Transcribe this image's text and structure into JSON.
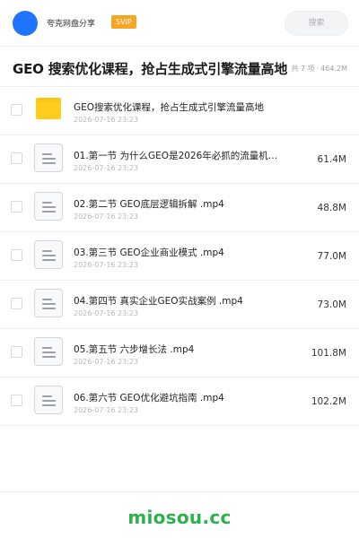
{
  "header": {
    "share_name": "夸克网盘分享",
    "badge": "SVIP",
    "search_placeholder": "搜索"
  },
  "title": "GEO 搜索优化课程，抢占生成式引擎流量高地",
  "summary": {
    "count": "共 7 项",
    "separator": "·",
    "total_size": "464.2M"
  },
  "items": [
    {
      "type": "folder",
      "name": "GEO搜索优化课程，抢占生成式引擎流量高地",
      "date": "2026-07-16 23:23",
      "size": ""
    },
    {
      "type": "file",
      "name": "01.第一节 为什么GEO是2026年必抓的流量机…",
      "date": "2026-07-16 23:23",
      "size": "61.4M"
    },
    {
      "type": "file",
      "name": "02.第二节 GEO底层逻辑拆解 .mp4",
      "date": "2026-07-16 23:23",
      "size": "48.8M"
    },
    {
      "type": "file",
      "name": "03.第三节 GEO企业商业模式 .mp4",
      "date": "2026-07-16 23:23",
      "size": "77.0M"
    },
    {
      "type": "file",
      "name": "04.第四节 真实企业GEO实战案例 .mp4",
      "date": "2026-07-16 23:23",
      "size": "73.0M"
    },
    {
      "type": "file",
      "name": "05.第五节 六步增长法 .mp4",
      "date": "2026-07-16 23:23",
      "size": "101.8M"
    },
    {
      "type": "file",
      "name": "06.第六节 GEO优化避坑指南 .mp4",
      "date": "2026-07-16 23:23",
      "size": "102.2M"
    }
  ],
  "footer": {
    "brand": "miosou.cc"
  },
  "colors": {
    "avatar": "#1f75fe",
    "badge": "#f5a623",
    "folder": "#fccd1c",
    "brand": "#2bb24c"
  },
  "icons": {
    "folder": "folder-icon",
    "file": "video-file-icon"
  }
}
